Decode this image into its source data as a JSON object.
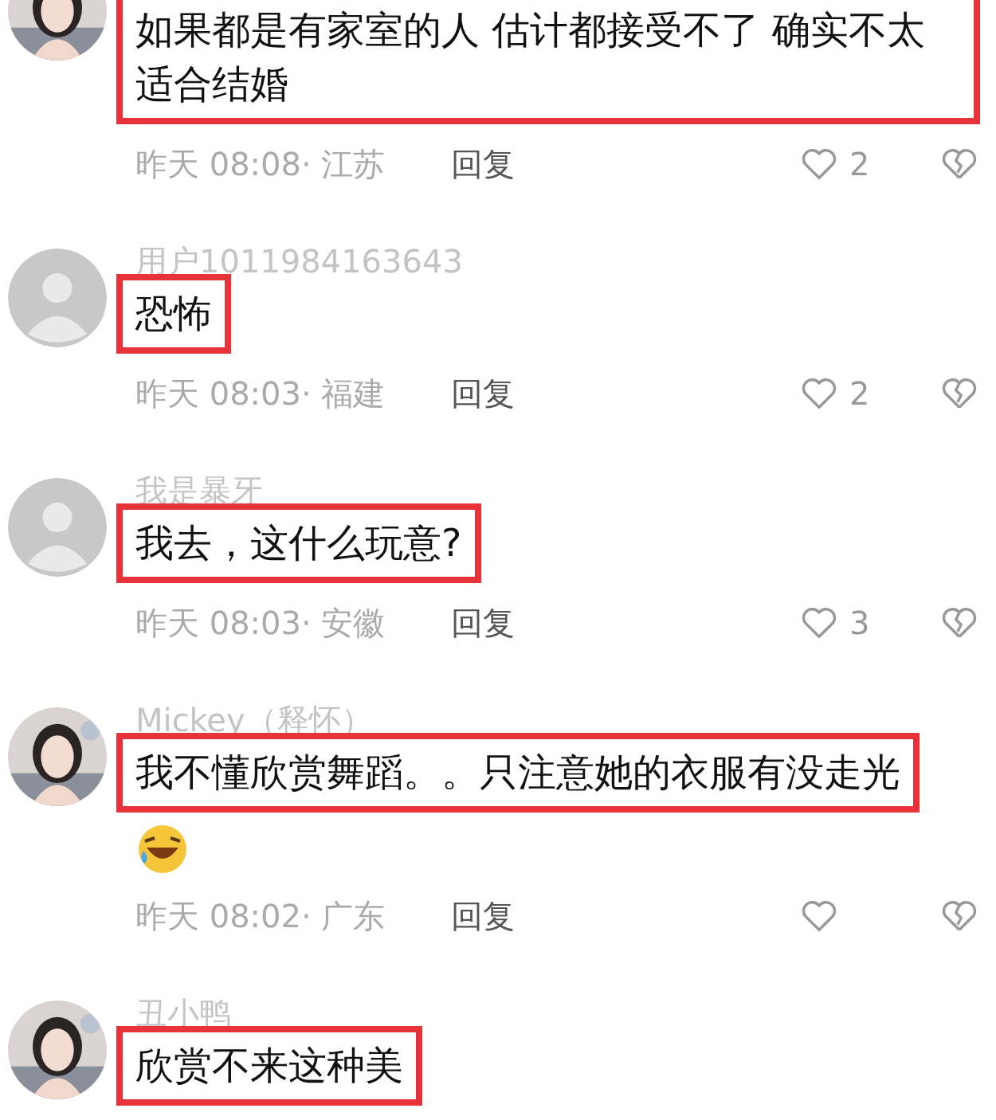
{
  "comments": [
    {
      "text": "如果都是有家室的人 估计都接受不了 确实不太适合结婚",
      "highlighted": true,
      "meta": "昨天 08:08· 江苏",
      "reply": "回复",
      "likes": "2",
      "liked": false
    },
    {
      "avatar": {
        "kind": "default"
      },
      "name": "用户1011984163643",
      "text": "恐怖",
      "highlighted": true,
      "meta": "昨天 08:03· 福建",
      "reply": "回复",
      "likes": "2",
      "liked": false
    },
    {
      "avatar": {
        "kind": "default"
      },
      "name": "我是暴牙",
      "text": "我去，这什么玩意?",
      "highlighted": true,
      "meta": "昨天 08:03· 安徽",
      "reply": "回复",
      "likes": "3",
      "liked": false
    },
    {
      "name": "Mickey（释怀）",
      "text": "我不懂欣赏舞蹈。。只注意她的衣服有没走光",
      "highlighted": true,
      "emoji": true,
      "meta": "昨天 08:02· 广东",
      "reply": "回复",
      "liked": false
    },
    {
      "name": "丑小鸭",
      "text": "欣赏不来这种美",
      "highlighted": true
    }
  ]
}
